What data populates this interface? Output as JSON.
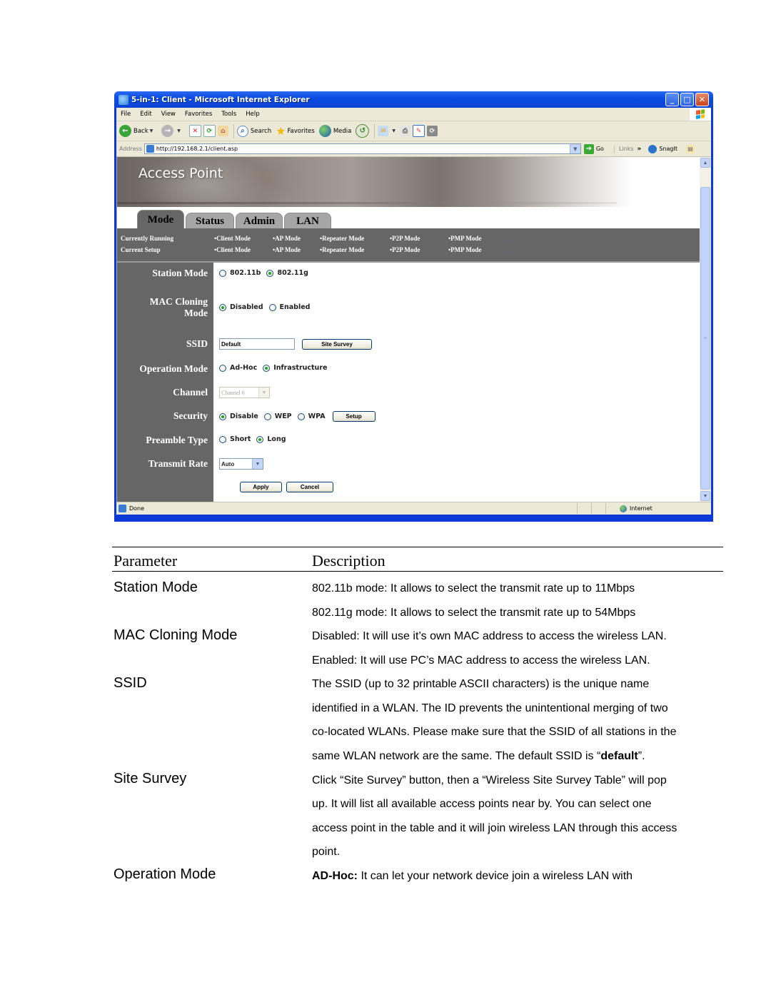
{
  "browser": {
    "window_title": "5-in-1: Client - Microsoft Internet Explorer",
    "menu": [
      "File",
      "Edit",
      "View",
      "Favorites",
      "Tools",
      "Help"
    ],
    "toolbar": {
      "back": "Back",
      "search": "Search",
      "favorites": "Favorites",
      "media": "Media"
    },
    "address_label": "Address",
    "address_url": "http://192.168.2.1/client.asp",
    "go_label": "Go",
    "links_label": "Links",
    "links_more": "»",
    "snagit_label": "SnagIt",
    "status_text": "Done",
    "zone_text": "Internet"
  },
  "page": {
    "banner_title": "Access Point",
    "tabs": [
      {
        "label": "Mode",
        "active": true
      },
      {
        "label": "Status",
        "active": false
      },
      {
        "label": "Admin",
        "active": false
      },
      {
        "label": "LAN",
        "active": false
      }
    ],
    "status_strip": {
      "rows": [
        {
          "label": "Currently Running",
          "modes": [
            "•Client Mode",
            "•AP Mode",
            "•Repeater Mode",
            "•P2P Mode",
            "•PMP Mode",
            "."
          ]
        },
        {
          "label": "Current Setup",
          "modes": [
            "•Client Mode",
            "•AP Mode",
            "•Repeater Mode",
            "•P2P Mode",
            "•PMP Mode",
            "."
          ]
        }
      ]
    },
    "form": {
      "station_mode": {
        "label": "Station Mode",
        "options": [
          {
            "label": "802.11b",
            "selected": false
          },
          {
            "label": "802.11g",
            "selected": true
          }
        ]
      },
      "mac_cloning": {
        "label_line1": "MAC Cloning",
        "label_line2": "Mode",
        "options": [
          {
            "label": "Disabled",
            "selected": true
          },
          {
            "label": "Enabled",
            "selected": false
          }
        ]
      },
      "ssid": {
        "label": "SSID",
        "value": "Default",
        "site_survey_button": "Site Survey"
      },
      "operation_mode": {
        "label": "Operation Mode",
        "options": [
          {
            "label": "Ad-Hoc",
            "selected": false
          },
          {
            "label": "Infrastructure",
            "selected": true
          }
        ]
      },
      "channel": {
        "label": "Channel",
        "value": "Channel 6",
        "disabled": true
      },
      "security": {
        "label": "Security",
        "options": [
          {
            "label": "Disable",
            "selected": true
          },
          {
            "label": "WEP",
            "selected": false
          },
          {
            "label": "WPA",
            "selected": false
          }
        ],
        "setup_button": "Setup"
      },
      "preamble": {
        "label": "Preamble Type",
        "options": [
          {
            "label": "Short",
            "selected": false
          },
          {
            "label": "Long",
            "selected": true
          }
        ]
      },
      "transmit_rate": {
        "label": "Transmit Rate",
        "value": "Auto"
      },
      "apply_button": "Apply",
      "cancel_button": "Cancel"
    }
  },
  "doc": {
    "header": {
      "parameter": "Parameter",
      "description": "Description"
    },
    "rows": [
      {
        "parameter": "Station Mode",
        "lines": [
          "802.11b mode: It allows to select the transmit rate up to 11Mbps",
          "802.11g mode: It allows to select the transmit rate up to 54Mbps"
        ]
      },
      {
        "parameter": "MAC Cloning Mode",
        "lines": [
          "Disabled: It will use it’s own MAC address to access the wireless LAN.",
          "Enabled: It will use PC’s MAC address to access the wireless LAN."
        ]
      },
      {
        "parameter": "SSID",
        "lines": [
          "The SSID (up to 32 printable ASCII characters) is the unique name",
          "identified in a WLAN. The ID prevents the unintentional merging of two",
          "co-located WLANs. Please make sure that the SSID of all stations in the"
        ],
        "last_line_prefix": "same WLAN network are the same. The default SSID is “",
        "last_line_bold": "default",
        "last_line_suffix": "”."
      },
      {
        "parameter": "Site Survey",
        "lines": [
          "Click “Site Survey” button, then a “Wireless Site Survey Table” will pop",
          "up. It will list all available access points near by. You can select one",
          "access point in the table and it will join wireless LAN through this access",
          "point."
        ]
      },
      {
        "parameter": "Operation Mode",
        "bold_prefix": "AD-Hoc:",
        "line_rest": " It can let your network device join a wireless LAN with"
      }
    ]
  }
}
